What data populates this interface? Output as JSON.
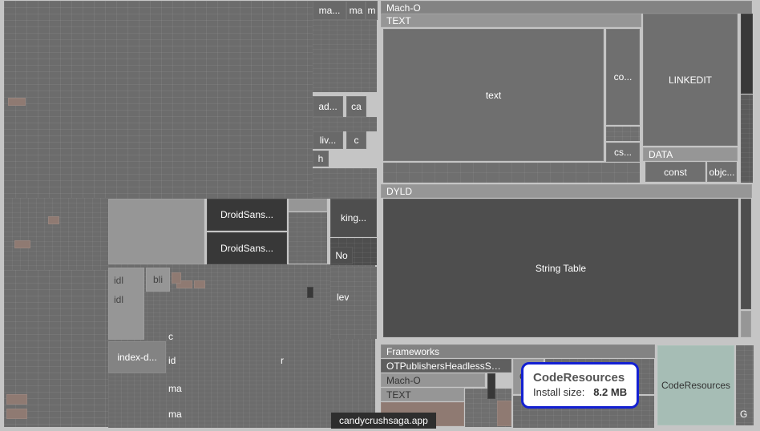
{
  "breadcrumb": "candycrushsaga.app",
  "tooltip": {
    "title": "CodeResources",
    "sizeLabel": "Install size:",
    "sizeValue": "8.2 MB"
  },
  "left": {
    "tiny": {
      "ma1": "ma...",
      "ma2": "ma",
      "m": "m",
      "ad": "ad...",
      "ca": "ca",
      "liv": "liv...",
      "c": "c",
      "h": "h",
      "droid1": "DroidSans...",
      "droid2": "DroidSans...",
      "king": "king...",
      "no": "No",
      "indexd": "index-d...",
      "idl1": "idl",
      "idl2": "idl",
      "bli": "bli",
      "c2": "c",
      "id": "id",
      "ma3": "ma",
      "ma4": "ma",
      "r": "r",
      "lev": "lev"
    }
  },
  "right": {
    "macho": {
      "title": "Mach-O"
    },
    "text_section": {
      "title": "TEXT"
    },
    "text_body": "text",
    "co": "co...",
    "cs": "cs...",
    "linkedit": "LINKEDIT",
    "data_section": {
      "title": "DATA"
    },
    "const": "const",
    "objc": "objc...",
    "dyld": {
      "title": "DYLD"
    },
    "string_table": "String Table"
  },
  "bottom": {
    "frameworks": {
      "title": "Frameworks"
    },
    "ot": "OTPublishersHeadlessSD...",
    "macho2": "Mach-O",
    "text2": "TEXT",
    "con": "Con",
    "coderes_highlight": "CodeResources",
    "g": "G"
  }
}
